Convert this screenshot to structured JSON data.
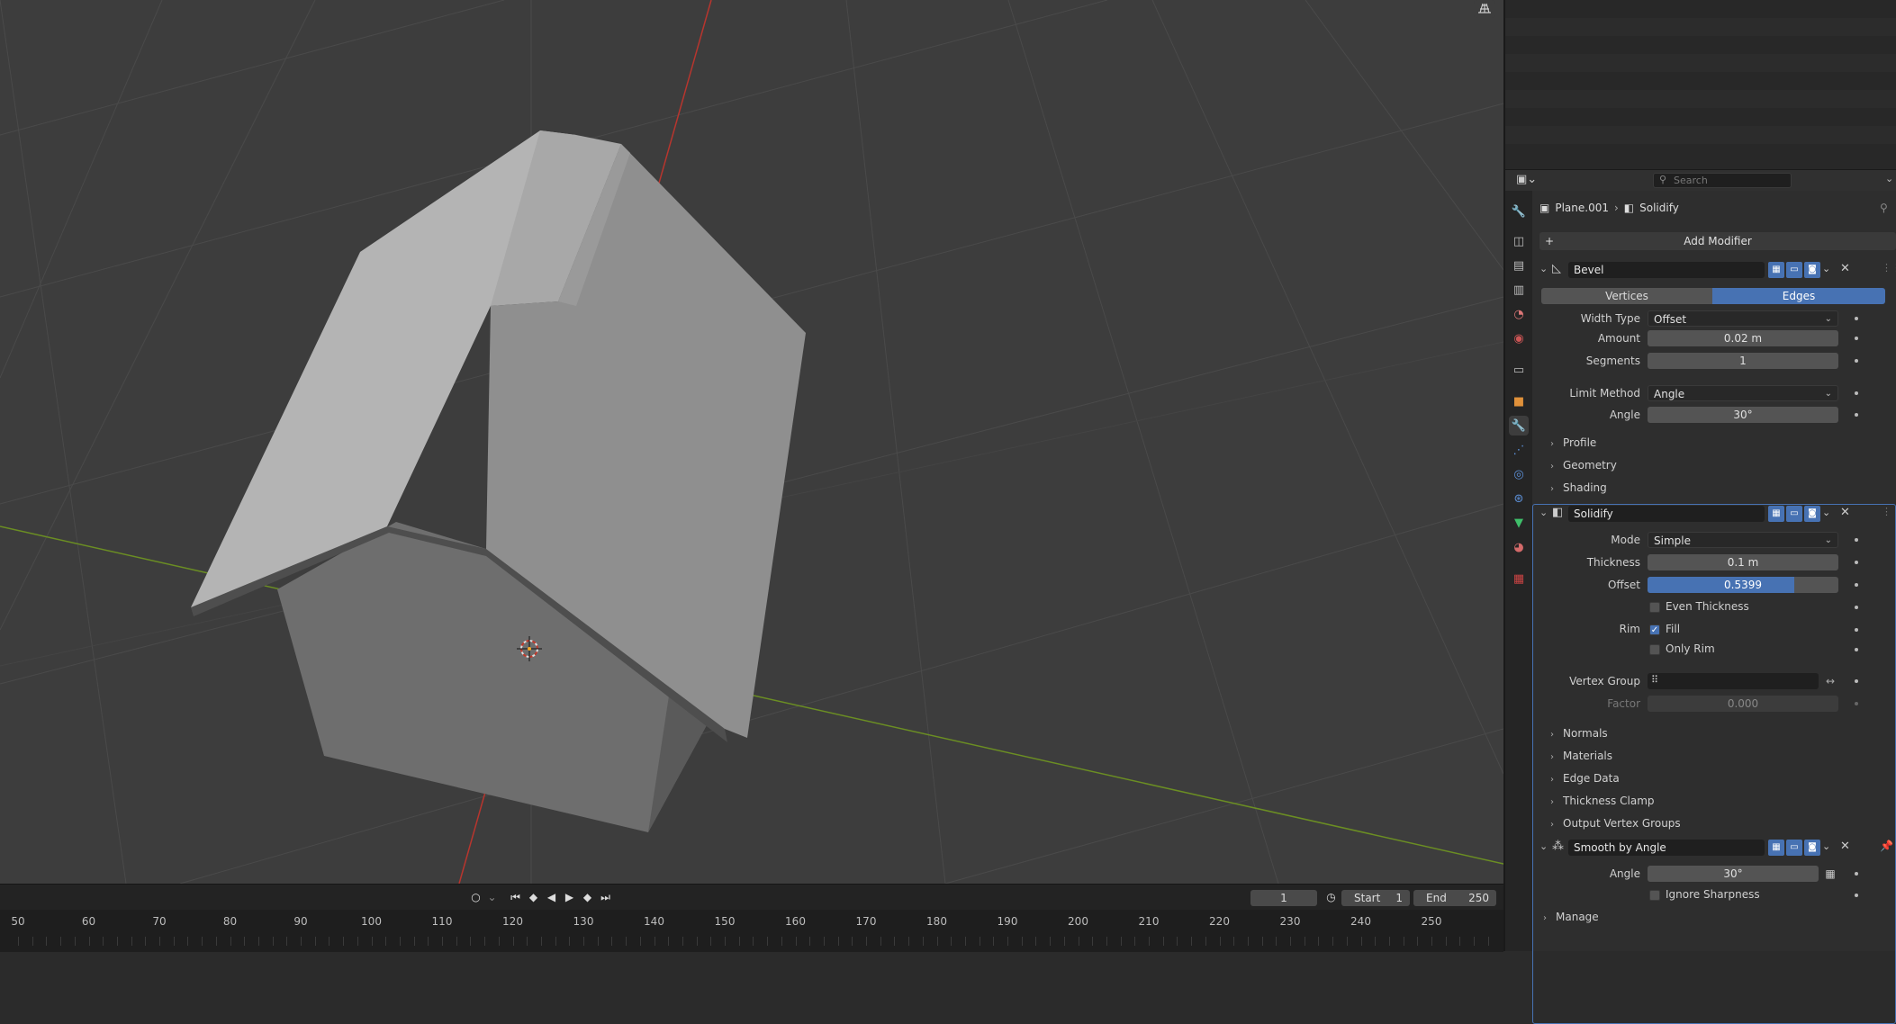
{
  "outliner": {
    "search_placeholder": "Search"
  },
  "breadcrumb": {
    "object": "Plane.001",
    "modifier": "Solidify"
  },
  "add_modifier_label": "Add Modifier",
  "bevel": {
    "name": "Bevel",
    "affect_vertices": "Vertices",
    "affect_edges": "Edges",
    "width_type_label": "Width Type",
    "width_type_value": "Offset",
    "amount_label": "Amount",
    "amount_value": "0.02 m",
    "segments_label": "Segments",
    "segments_value": "1",
    "limit_method_label": "Limit Method",
    "limit_method_value": "Angle",
    "angle_label": "Angle",
    "angle_value": "30°",
    "sub_profile": "Profile",
    "sub_geometry": "Geometry",
    "sub_shading": "Shading"
  },
  "solidify": {
    "name": "Solidify",
    "mode_label": "Mode",
    "mode_value": "Simple",
    "thickness_label": "Thickness",
    "thickness_value": "0.1 m",
    "offset_label": "Offset",
    "offset_value": "0.5399",
    "offset_fraction": 0.77,
    "even_thickness_label": "Even Thickness",
    "rim_label": "Rim",
    "fill_label": "Fill",
    "only_rim_label": "Only Rim",
    "vertex_group_label": "Vertex Group",
    "factor_label": "Factor",
    "factor_value": "0.000",
    "sub_normals": "Normals",
    "sub_materials": "Materials",
    "sub_edge_data": "Edge Data",
    "sub_thickness_clamp": "Thickness Clamp",
    "sub_output_vertex_groups": "Output Vertex Groups"
  },
  "smooth": {
    "name": "Smooth by Angle",
    "angle_label": "Angle",
    "angle_value": "30°",
    "ignore_sharpness_label": "Ignore Sharpness",
    "manage_label": "Manage"
  },
  "timeline": {
    "current_frame": "1",
    "start_label": "Start",
    "start_value": "1",
    "end_label": "End",
    "end_value": "250",
    "ruler": [
      "50",
      "60",
      "70",
      "80",
      "90",
      "100",
      "110",
      "120",
      "130",
      "140",
      "150",
      "160",
      "170",
      "180",
      "190",
      "200",
      "210",
      "220",
      "230",
      "240",
      "250"
    ]
  },
  "colors": {
    "accent": "#4772b3",
    "x_axis": "#c0392b",
    "y_axis": "#7fa531"
  }
}
